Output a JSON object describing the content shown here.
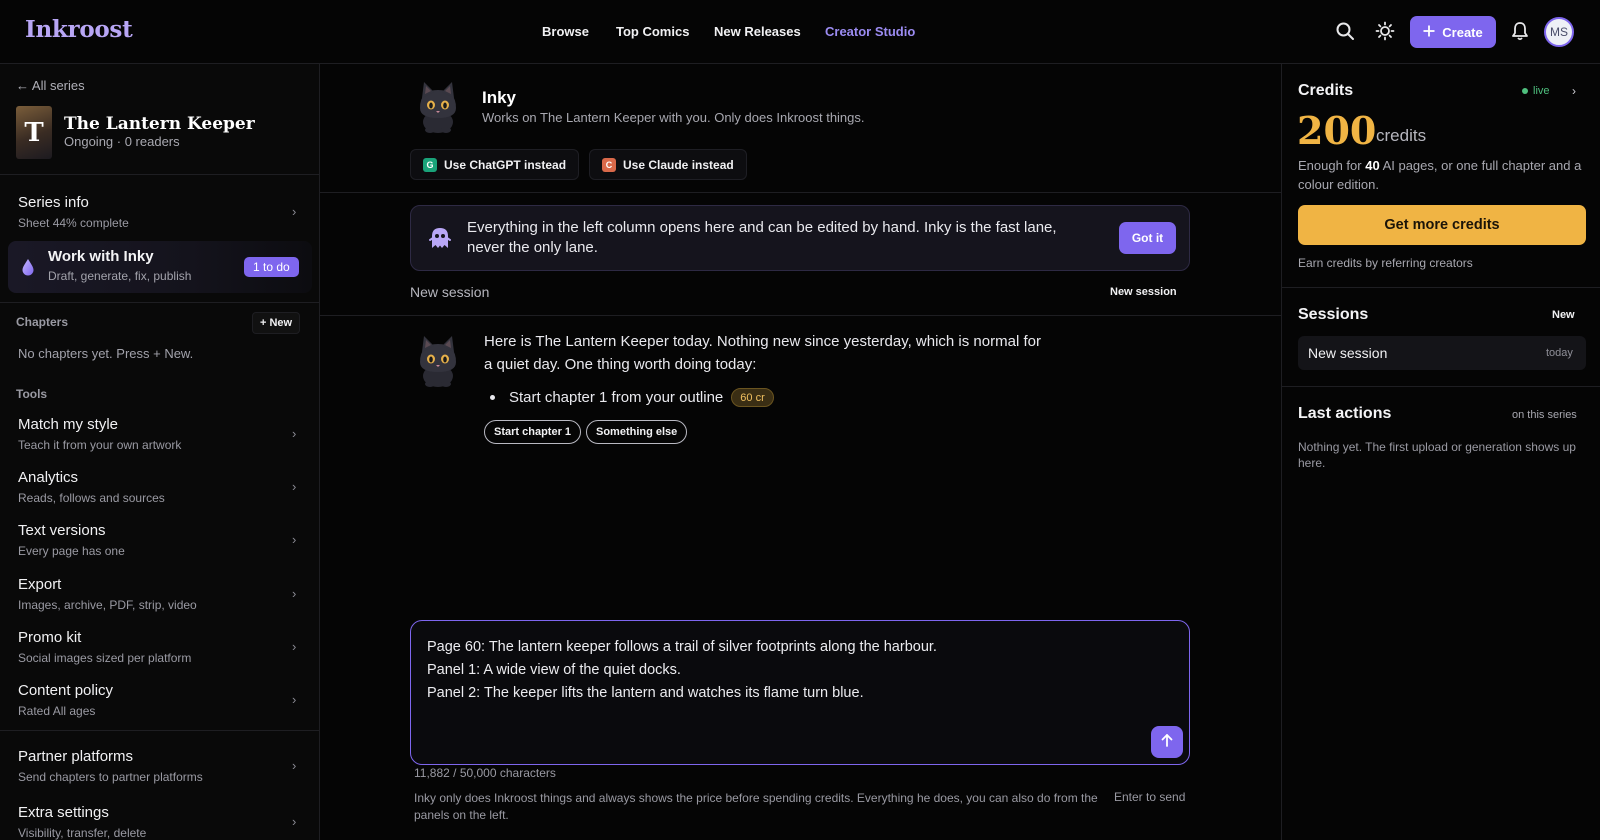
{
  "app": {
    "logo": "Inkroost",
    "nav": [
      "Browse",
      "Top Comics",
      "New Releases",
      "Creator Studio"
    ],
    "active_nav": "Creator Studio",
    "create_label": "Create",
    "avatar_initials": "MS",
    "accent_color": "#7e66ee",
    "credit_color": "#f0b444"
  },
  "sidebar": {
    "back_link": "← All series",
    "cover_letter": "T",
    "series_title": "The Lantern Keeper",
    "series_sub": "Ongoing · 0 readers",
    "series_info": {
      "title": "Series info",
      "sub": "Sheet 44% complete"
    },
    "inky_row": {
      "title": "Work with Inky",
      "sub": "Draft, generate, fix, publish",
      "badge": "1 to do"
    },
    "chapters_label": "Chapters",
    "chapters_new": "+ New",
    "chapters_empty": "No chapters yet. Press + New.",
    "tools_label": "Tools",
    "tools": [
      {
        "title": "Match my style",
        "sub": "Teach it from your own artwork"
      },
      {
        "title": "Analytics",
        "sub": "Reads, follows and sources"
      },
      {
        "title": "Text versions",
        "sub": "Every page has one"
      },
      {
        "title": "Export",
        "sub": "Images, archive, PDF, strip, video"
      },
      {
        "title": "Promo kit",
        "sub": "Social images sized per platform"
      },
      {
        "title": "Content policy",
        "sub": "Rated All ages"
      }
    ],
    "bottom": [
      {
        "title": "Partner platforms",
        "sub": "Send chapters to partner platforms"
      },
      {
        "title": "Extra settings",
        "sub": "Visibility, transfer, delete"
      }
    ]
  },
  "agent": {
    "name": "Inky",
    "sub": "Works on The Lantern Keeper with you. Only does Inkroost things.",
    "alt_chatgpt": "Use ChatGPT instead",
    "alt_claude": "Use Claude instead"
  },
  "banner": {
    "text": "Everything in the left column opens here and can be edited by hand. Inky is the fast lane, never the only lane.",
    "button": "Got it"
  },
  "session": {
    "label": "New session",
    "new_button": "New session"
  },
  "message": {
    "text": "Here is The Lantern Keeper today. Nothing new since yesterday, which is normal for a quiet day. One thing worth doing today:",
    "bullet": "Start chapter 1 from your outline",
    "cost": "60 cr",
    "chips": [
      "Start chapter 1",
      "Something else"
    ]
  },
  "composer": {
    "lines": [
      "Page 60: The lantern keeper follows a trail of silver footprints along the harbour.",
      "Panel 1: A wide view of the quiet docks.",
      "Panel 2: The keeper lifts the lantern and watches its flame turn blue."
    ],
    "char_count": "11,882 / 50,000 characters",
    "footer_note": "Inky only does Inkroost things and always shows the price before spending credits. Everything he does, you can also do from the panels on the left.",
    "enter_note": "Enter to send"
  },
  "credits": {
    "title": "Credits",
    "live": "live",
    "amount": "200",
    "unit": "credits",
    "desc_prefix": "Enough for ",
    "desc_bold": "40",
    "desc_suffix": " AI pages, or one full chapter and a colour edition.",
    "button": "Get more credits",
    "referral": "Earn credits by referring creators"
  },
  "sessions": {
    "title": "Sessions",
    "new_label": "New",
    "items": [
      {
        "name": "New session",
        "date": "today"
      }
    ]
  },
  "last_actions": {
    "title": "Last actions",
    "scope": "on this series",
    "empty": "Nothing yet. The first upload or generation shows up here."
  }
}
